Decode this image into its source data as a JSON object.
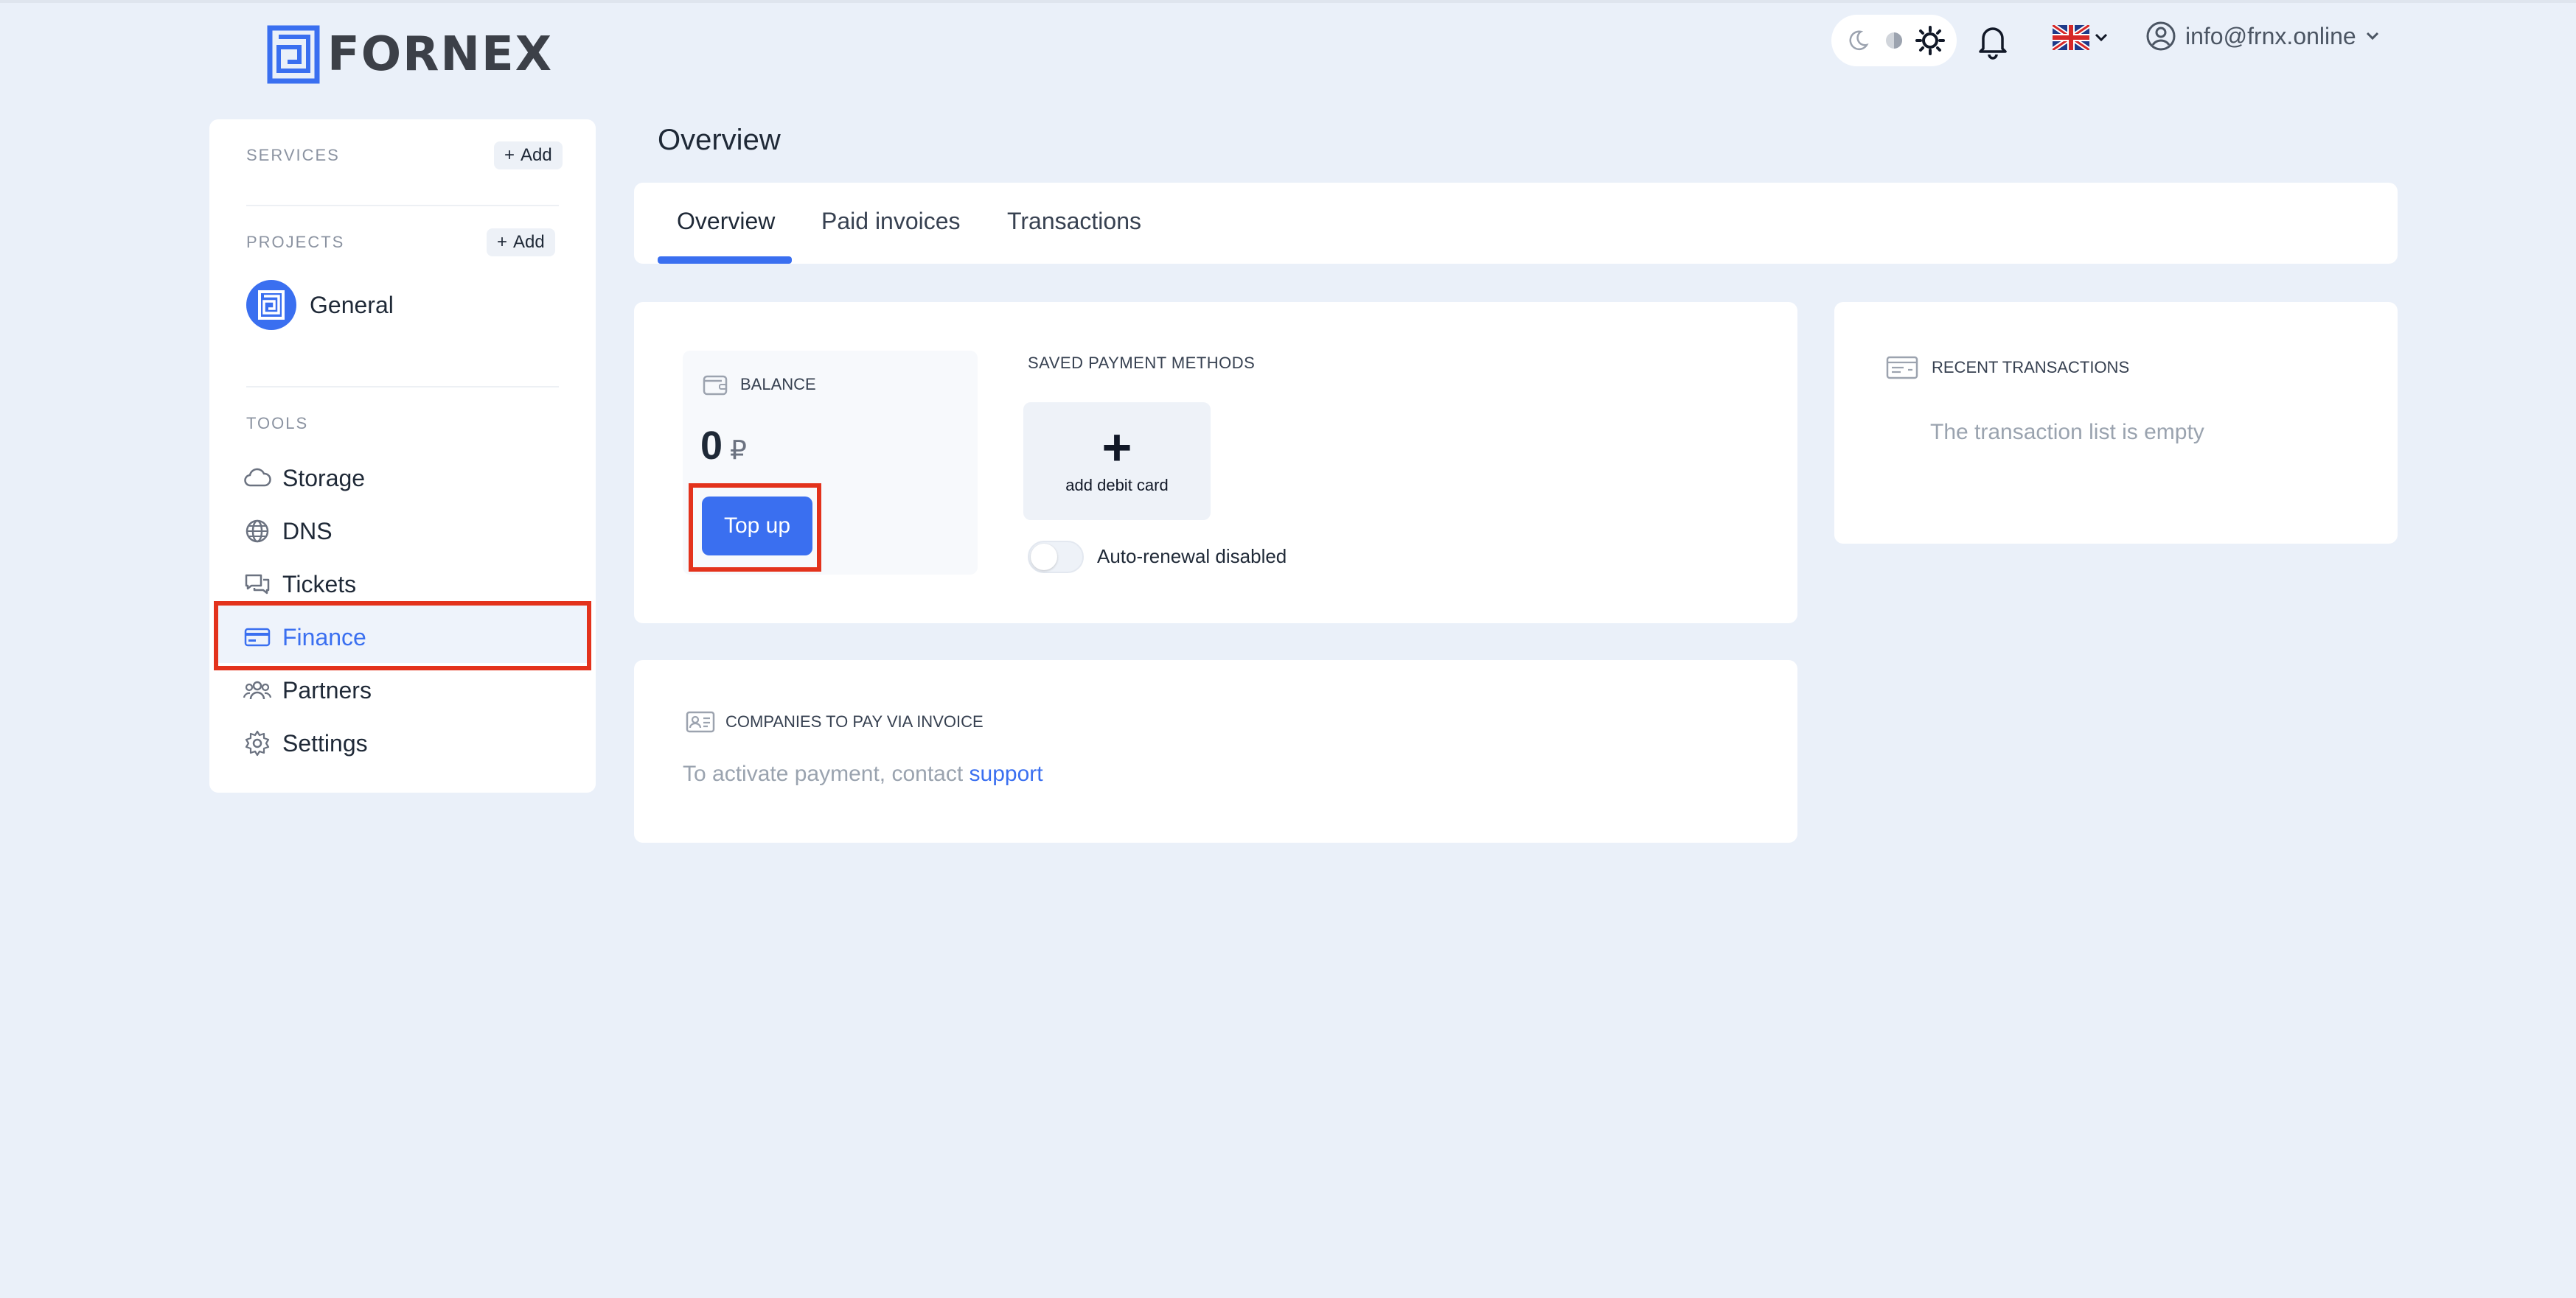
{
  "brand": {
    "name": "FORNEX"
  },
  "header": {
    "theme_options": [
      "moon-icon",
      "half-icon",
      "sun-icon"
    ],
    "language": "uk-flag",
    "account_email": "info@frnx.online"
  },
  "sidebar": {
    "services_title": "SERVICES",
    "services_add": "Add",
    "projects_title": "PROJECTS",
    "projects_add": "Add",
    "projects": [
      {
        "label": "General"
      }
    ],
    "tools_title": "TOOLS",
    "tools": [
      {
        "label": "Storage",
        "icon": "cloud-icon"
      },
      {
        "label": "DNS",
        "icon": "globe-icon"
      },
      {
        "label": "Tickets",
        "icon": "chat-icon"
      },
      {
        "label": "Finance",
        "icon": "card-icon",
        "active": true
      },
      {
        "label": "Partners",
        "icon": "users-icon"
      },
      {
        "label": "Settings",
        "icon": "gear-icon"
      }
    ]
  },
  "main": {
    "title": "Overview",
    "tabs": [
      {
        "label": "Overview",
        "active": true
      },
      {
        "label": "Paid invoices"
      },
      {
        "label": "Transactions"
      }
    ],
    "balance": {
      "title": "BALANCE",
      "value": "0",
      "currency": "₽",
      "topup_label": "Top up"
    },
    "payment_methods": {
      "title": "SAVED PAYMENT METHODS",
      "add_card_plus": "+",
      "add_card_label": "add debit card",
      "auto_renewal_label": "Auto-renewal disabled"
    },
    "recent_transactions": {
      "title": "RECENT TRANSACTIONS",
      "empty": "The transaction list is empty"
    },
    "invoice": {
      "title": "COMPANIES TO PAY VIA INVOICE",
      "text": "To activate payment, contact",
      "link": "support"
    }
  },
  "colors": {
    "accent": "#3a6ff0",
    "background": "#eaf0f9",
    "highlight": "#e3321c"
  }
}
